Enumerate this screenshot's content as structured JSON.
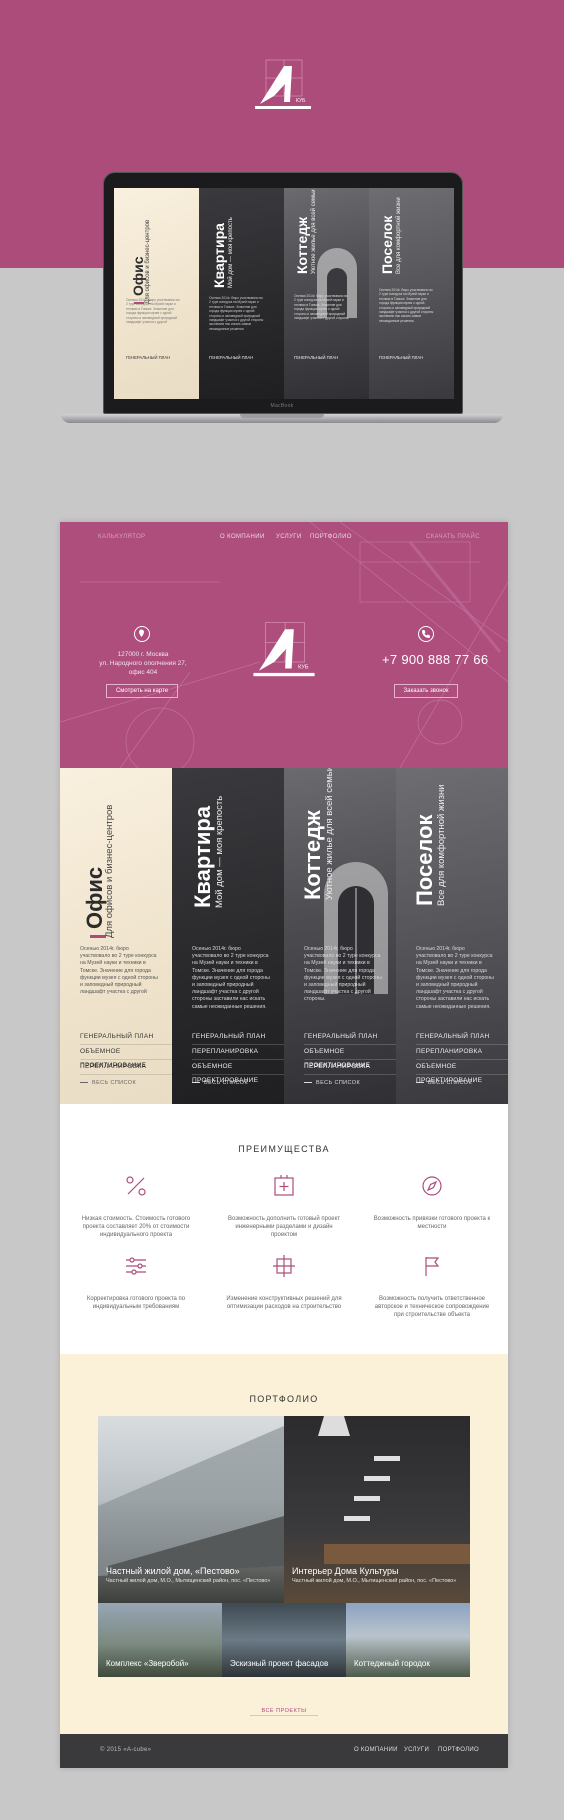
{
  "laptop": {
    "label": "MacBook"
  },
  "columns": [
    {
      "title": "Офис",
      "subtitle": "Для офисов и бизнес-центров",
      "desc": "Осенью 2014г. бюро участвовало во 2 туре конкурса на Музей науки и техники в Томске. Значение для города функции музея с одной стороны и заповедный природный ландшафт участка с другой",
      "links": [
        "ГЕНЕРАЛЬНЫЙ ПЛАН",
        "ОБЪЕМНОЕ ПРОЕКТИРОВАНИЕ",
        "ПЕРЕПЛАНИРОВКА"
      ],
      "all": "ВЕСЬ СПИСОК"
    },
    {
      "title": "Квартира",
      "subtitle": "Мой дом — моя крепость",
      "desc": "Осенью 2014г. бюро участвовало во 2 туре конкурса на Музей науки и техники в Томске. Значение для города функции музея с одной стороны и заповедный природный ландшафт участка с другой стороны заставили нас искать самые неожиданные решения.",
      "links": [
        "ГЕНЕРАЛЬНЫЙ ПЛАН",
        "ПЕРЕПЛАНИРОВКА",
        "ОБЪЕМНОЕ ПРОЕКТИРОВАНИЕ"
      ],
      "all": "ВЕСЬ СПИСОК"
    },
    {
      "title": "Коттедж",
      "subtitle": "Уютное жилье для всей семьи",
      "desc": "Осенью 2014г. бюро участвовало во 2 туре конкурса на Музей науки и техники в Томске. Значение для города функции музея с одной стороны и заповедный природный ландшафт участка с другой стороны.",
      "links": [
        "ГЕНЕРАЛЬНЫЙ ПЛАН",
        "ОБЪЕМНОЕ ПРОЕКТИРОВАНИЕ",
        "ПЕРЕПЛАНИРОВКА"
      ],
      "all": "ВЕСЬ СПИСОК"
    },
    {
      "title": "Поселок",
      "subtitle": "Все для комфортной жизни",
      "desc": "Осенью 2014г. бюро участвовало во 2 туре конкурса на Музей науки и техники в Томске. Значение для города функции музея с одной стороны и заповедный природный ландшафт участка с другой стороны заставили нас искать самые неожиданные решения.",
      "links": [
        "ГЕНЕРАЛЬНЫЙ ПЛАН",
        "ПЕРЕПЛАНИРОВКА",
        "ОБЪЕМНОЕ ПРОЕКТИРОВАНИЕ"
      ],
      "all": "ВЕСЬ СПИСОК"
    }
  ],
  "laptop_columns": [
    {
      "title": "Офис",
      "subtitle": "Для офисов и бизнес-центров",
      "link": "ГЕНЕРАЛЬНЫЙ ПЛАН"
    },
    {
      "title": "Квартира",
      "subtitle": "Мой дом — моя крепость",
      "link": "ГЕНЕРАЛЬНЫЙ ПЛАН"
    },
    {
      "title": "Коттедж",
      "subtitle": "Уютное жилье для всей семьи",
      "link": "ГЕНЕРАЛЬНЫЙ ПЛАН"
    },
    {
      "title": "Поселок",
      "subtitle": "Все для комфортной жизни",
      "link": "ГЕНЕРАЛЬНЫЙ ПЛАН"
    }
  ],
  "nav": {
    "calculator": "КАЛЬКУЛЯТОР",
    "about": "О КОМПАНИИ",
    "services": "УСЛУГИ",
    "portfolio": "ПОРТФОЛИО",
    "price": "СКАЧАТЬ ПРАЙС"
  },
  "contacts": {
    "address_line1": "127000 г. Москва",
    "address_line2": "ул. Народного ополчения 27,",
    "address_line3": "офис 404",
    "map_button": "Смотреть на карте",
    "phone": "+7 900 888 77 66",
    "call_button": "Заказать звонок"
  },
  "logo_text": "КУБ",
  "advantages": {
    "title": "ПРЕИМУЩЕСТВА",
    "items": [
      {
        "icon": "percent-icon",
        "text": "Низкая стоимость. Стоимость готового проекта составляет 20% от стоимости индивидуального проекта"
      },
      {
        "icon": "plus-square-icon",
        "text": "Возможность дополнить готовый проект инженерными разделами и дизайн проектом"
      },
      {
        "icon": "compass-icon",
        "text": "Возможность привязки готового проекта к местности"
      },
      {
        "icon": "sliders-icon",
        "text": "Корректировка готового проекта по индивидуальным требованиям"
      },
      {
        "icon": "resize-icon",
        "text": "Изменение конструктивных решений для оптимизации расходов на строительство"
      },
      {
        "icon": "flag-icon",
        "text": "Возможность получить ответственное авторское и техническое сопровождение при строительстве объекта"
      }
    ]
  },
  "portfolio": {
    "title": "ПОРТФОЛИО",
    "tiles": [
      {
        "title": "Частный жилой дом, «Пестово»",
        "sub": "Частный жилой дом, М.О., Мытищенский район, пос. «Пестово»"
      },
      {
        "title": "Интерьер Дома Культуры",
        "sub": "Частный жилой дом, М.О., Мытищенский район, пос. «Пестово»"
      },
      {
        "title": "Комплекс «Зверобой»",
        "sub": ""
      },
      {
        "title": "Эскизный проект фасадов",
        "sub": ""
      },
      {
        "title": "Коттеджный городок",
        "sub": ""
      }
    ],
    "all": "ВСЕ ПРОЕКТЫ"
  },
  "footer": {
    "copy": "© 2015 «A-cube»",
    "about": "О КОМПАНИИ",
    "services": "УСЛУГИ",
    "portfolio": "ПОРТФОЛИО"
  },
  "colors": {
    "accent": "#ac4c7b",
    "cream": "#fbf0d8",
    "footer": "#3a3a3c"
  }
}
